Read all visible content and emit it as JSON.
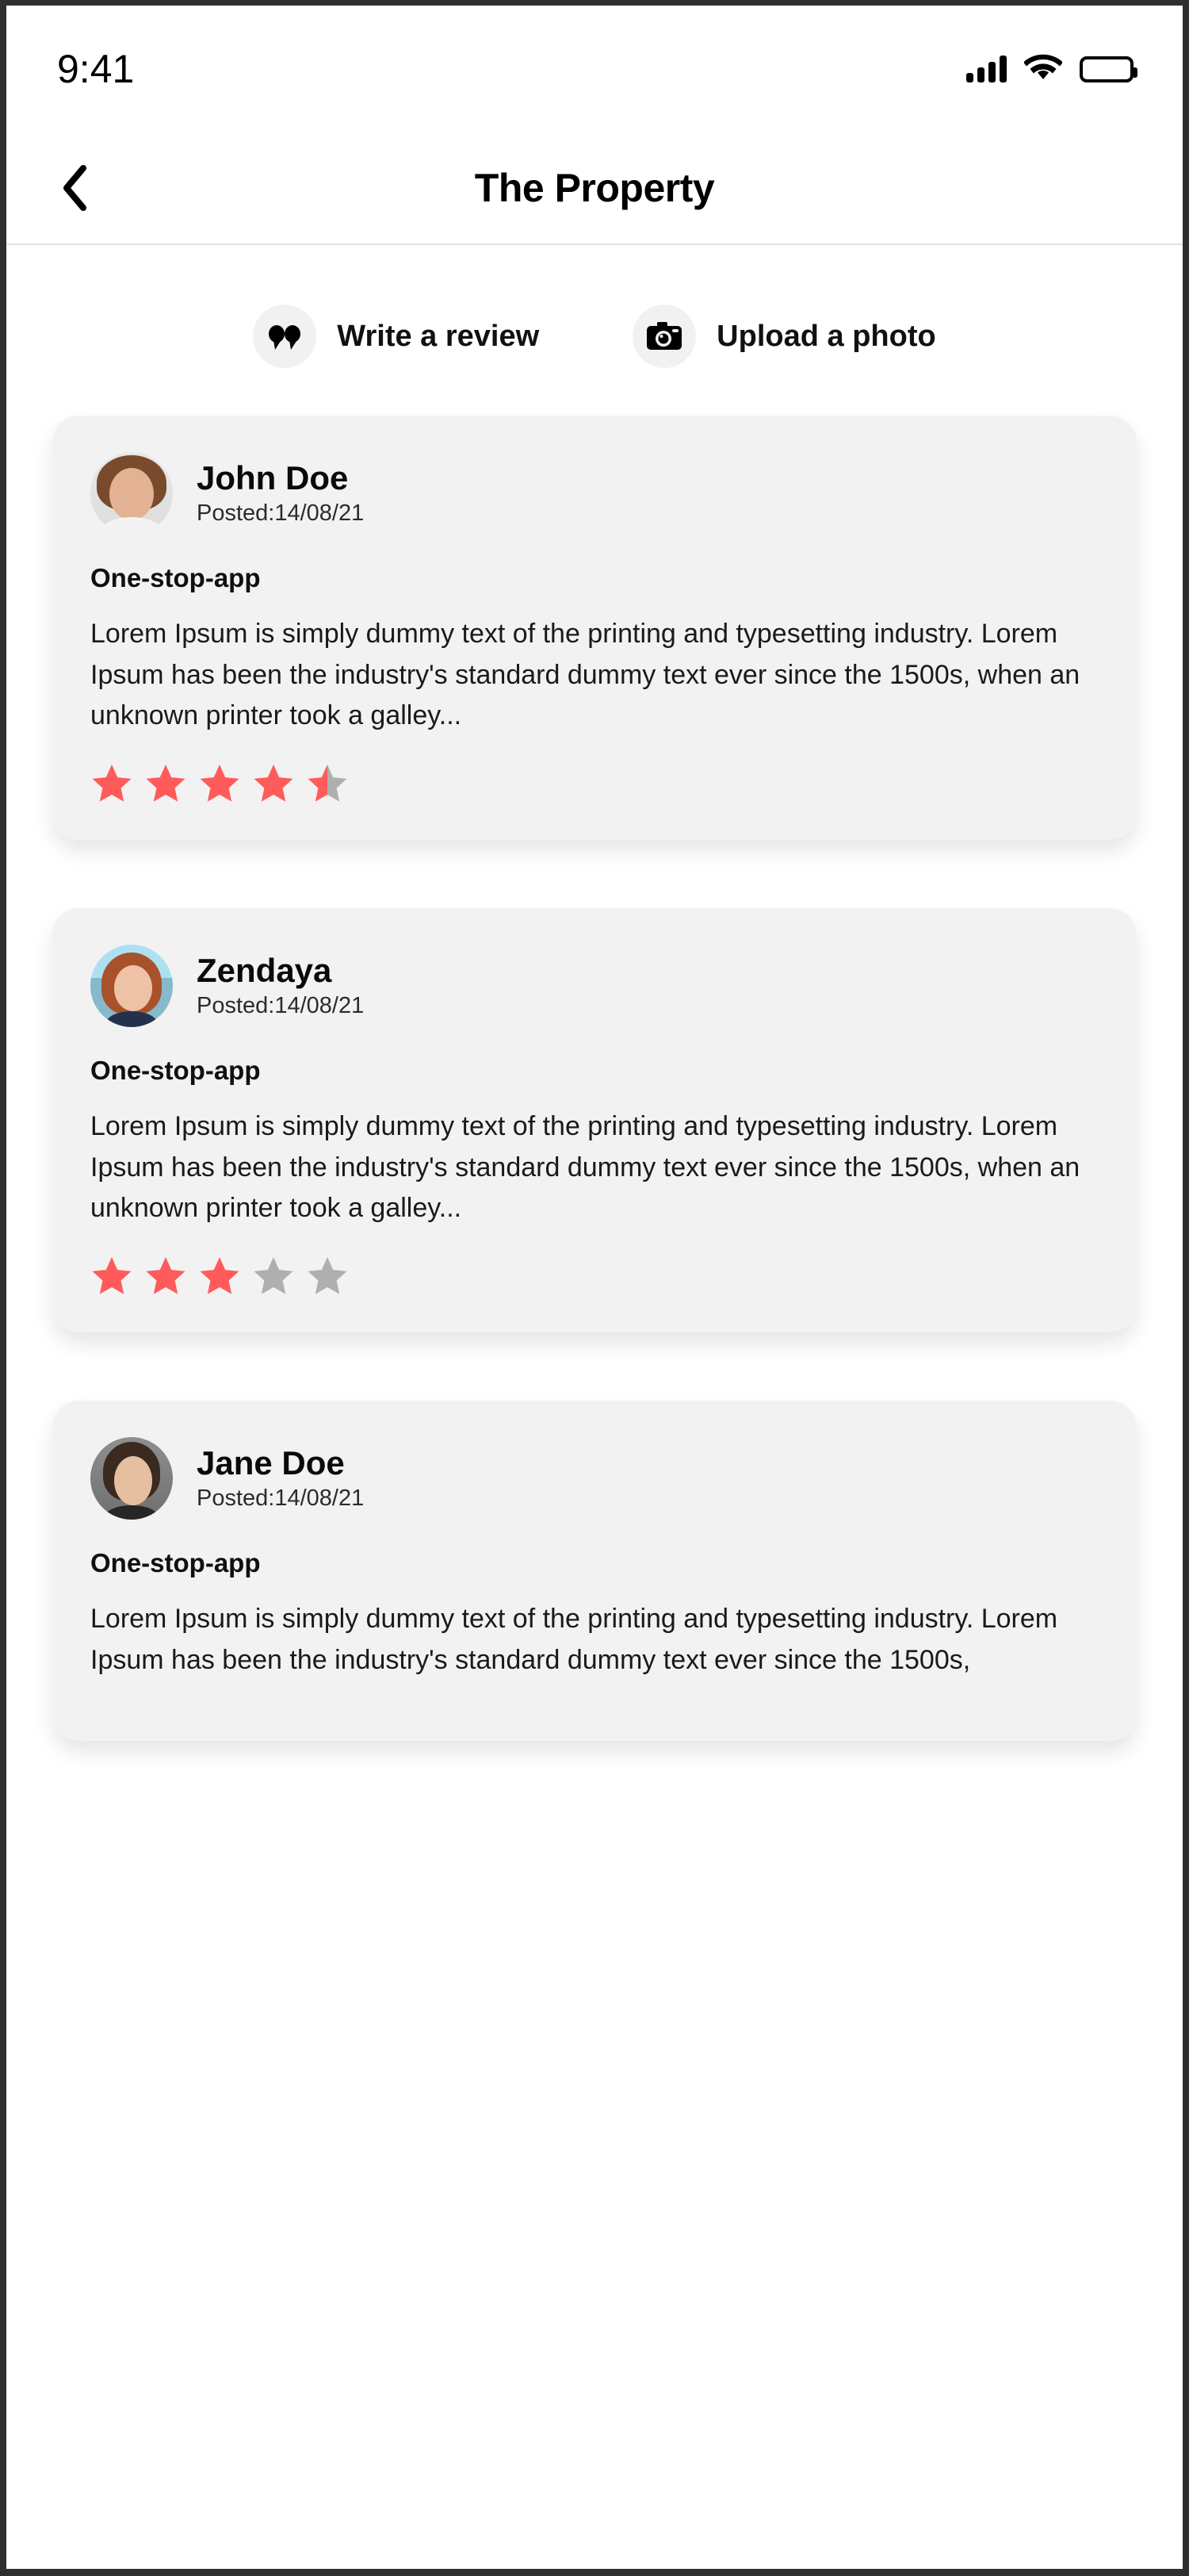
{
  "status_bar": {
    "time": "9:41",
    "signal_icon": "cellular-signal-icon",
    "wifi_icon": "wifi-icon",
    "battery_icon": "battery-full-icon"
  },
  "header": {
    "back_icon": "chevron-left-icon",
    "title": "The Property"
  },
  "actions": [
    {
      "icon": "quote-bubble-icon",
      "label": "Write a review"
    },
    {
      "icon": "camera-icon",
      "label": "Upload a photo"
    }
  ],
  "colors": {
    "star_filled": "#FF5B5B",
    "star_empty": "#AFAFAF",
    "card_bg": "#F2F2F2",
    "page_bg": "#FFFFFF"
  },
  "reviews": [
    {
      "name": "John Doe",
      "posted": "Posted:14/08/21",
      "title": "One-stop-app",
      "body": "Lorem Ipsum is simply dummy text of the printing and typesetting industry. Lorem Ipsum has been the industry's standard dummy text ever since the 1500s, when an unknown printer took a galley...",
      "rating": 4.5,
      "max_rating": 5,
      "avatar_alt": "john-doe-avatar"
    },
    {
      "name": "Zendaya",
      "posted": "Posted:14/08/21",
      "title": "One-stop-app",
      "body": "Lorem Ipsum is simply dummy text of the printing and typesetting industry. Lorem Ipsum has been the industry's standard dummy text ever since the 1500s, when an unknown printer took a galley...",
      "rating": 3,
      "max_rating": 5,
      "avatar_alt": "zendaya-avatar"
    },
    {
      "name": "Jane Doe",
      "posted": "Posted:14/08/21",
      "title": "One-stop-app",
      "body": "Lorem Ipsum is simply dummy text of the printing and typesetting industry. Lorem Ipsum has been the industry's standard dummy text ever since the 1500s,",
      "rating": 0,
      "max_rating": 5,
      "avatar_alt": "jane-doe-avatar"
    }
  ]
}
